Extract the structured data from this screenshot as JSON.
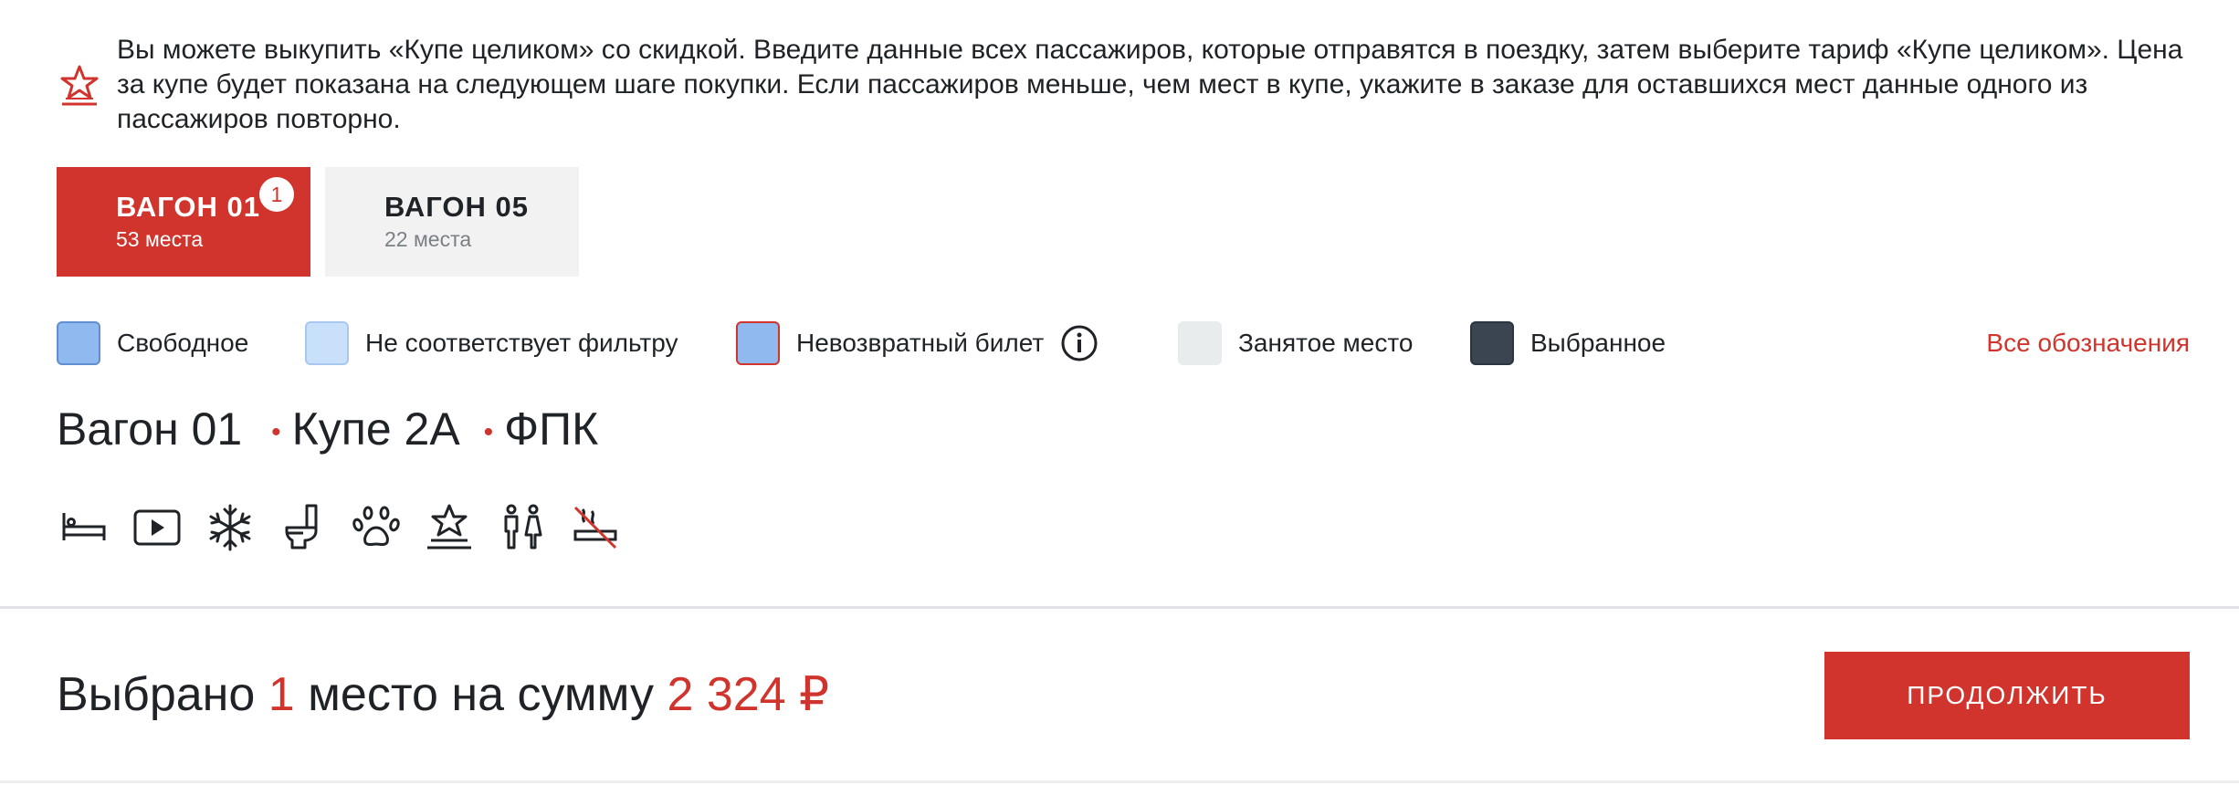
{
  "notice": {
    "icon": "star-podium-icon",
    "text": "Вы можете выкупить «Купе целиком» со скидкой. Введите данные всех пассажиров, которые отправятся в поездку, затем выберите тариф «Купе целиком». Цена за купе будет показана на следующем шаге покупки. Если пассажиров меньше, чем мест в купе, укажите в заказе для оставшихся мест данные одного из пассажиров повторно."
  },
  "wagons": [
    {
      "title": "ВАГОН 01",
      "subtitle": "53 места",
      "badge": "1",
      "active": true
    },
    {
      "title": "ВАГОН 05",
      "subtitle": "22 места",
      "active": false
    }
  ],
  "legend": {
    "items": [
      {
        "label": "Свободное",
        "fill": "#8fb9ef",
        "border": "#5f8fcf"
      },
      {
        "label": "Не соответствует фильтру",
        "fill": "#c9e0fb",
        "border": "#a9c8ef"
      },
      {
        "label": "Невозвратный билет",
        "fill": "#8fb9ef",
        "border": "#d0342c"
      },
      {
        "label": "Занятое место",
        "fill": "#e8ecec",
        "border": "#e8ecec"
      },
      {
        "label": "Выбранное",
        "fill": "#3b4552",
        "border": "#2c343e"
      }
    ],
    "all_link": "Все обозначения"
  },
  "heading": {
    "wagon": "Вагон 01",
    "coupe": "Купе 2А",
    "carrier": "ФПК",
    "separator": "•"
  },
  "amenities": [
    "bed-icon",
    "video-icon",
    "snowflake-icon",
    "toilet-icon",
    "paw-icon",
    "star-podium-icon",
    "restroom-icon",
    "no-smoking-icon"
  ],
  "summary": {
    "prefix": "Выбрано",
    "count": "1",
    "middle": "место на сумму",
    "amount": "2 324 ₽"
  },
  "continue_button": "ПРОДОЛЖИТЬ",
  "colors": {
    "accent": "#d0342c",
    "text": "#1f2226"
  }
}
